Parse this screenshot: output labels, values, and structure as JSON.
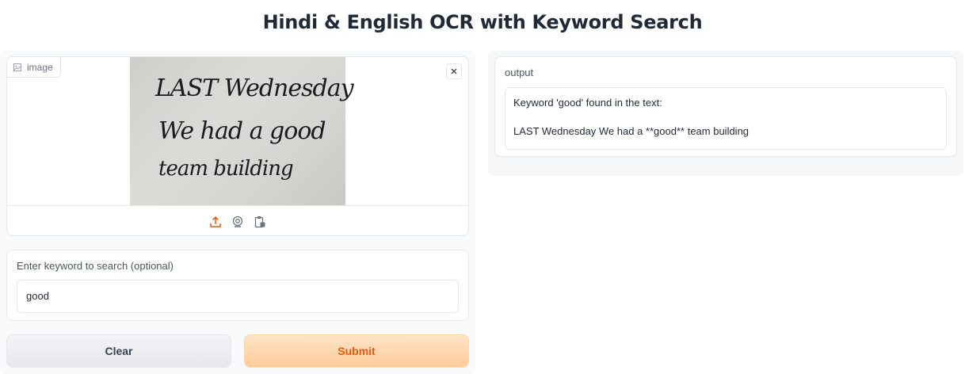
{
  "page": {
    "title": "Hindi & English OCR with Keyword Search"
  },
  "image_input": {
    "label": "image",
    "handwriting_lines": [
      "LAST Wednesday",
      "We had a good",
      "team building"
    ],
    "toolbar": [
      "upload-icon",
      "webcam-icon",
      "clipboard-icon"
    ]
  },
  "keyword": {
    "label": "Enter keyword to search (optional)",
    "value": "good"
  },
  "buttons": {
    "clear": "Clear",
    "submit": "Submit"
  },
  "output": {
    "label": "output",
    "text": "Keyword 'good' found in the text:\n\nLAST Wednesday We had a **good** team building"
  },
  "colors": {
    "accent": "#ea580c",
    "submit_bg": "#fdcb97",
    "border": "#e5e7eb"
  }
}
